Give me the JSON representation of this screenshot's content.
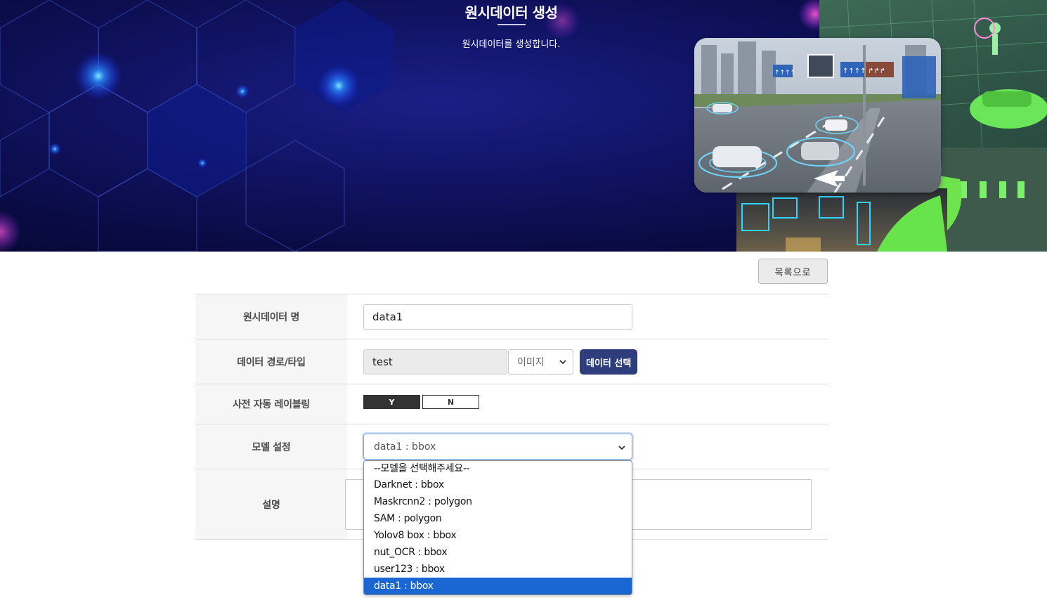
{
  "hero": {
    "title": "원시데이터 생성",
    "subtitle": "원시데이터를 생성합니다."
  },
  "actions": {
    "list_button": "목록으로"
  },
  "form": {
    "name": {
      "label": "원시데이터 명",
      "value": "data1"
    },
    "path": {
      "label": "데이터 경로/타입",
      "value": "test",
      "type_selected": "이미지",
      "select_button": "데이터 선택"
    },
    "auto_label": {
      "label": "사전 자동 레이블링",
      "yes": "Y",
      "no": "N",
      "selected": "Y"
    },
    "model": {
      "label": "모델 설정",
      "selected": "data1 : bbox"
    },
    "description": {
      "label": "설명",
      "value": ""
    }
  },
  "model_dropdown": {
    "options": [
      "--모델을 선택해주세요--",
      "Darknet : bbox",
      "Maskrcnn2 : polygon",
      "SAM : polygon",
      "Yolov8 box : bbox",
      "nut_OCR : bbox",
      "user123 : bbox",
      "data1 : bbox"
    ],
    "highlighted_index": 7
  },
  "road_signs": [
    "↑↑↑↑",
    "↑↑↑↑",
    "↱↱↱"
  ],
  "colors": {
    "hero_bg": "#111466",
    "primary_button": "#2e3d7c",
    "toggle_on": "#333333",
    "option_highlight": "#1a66d2"
  }
}
